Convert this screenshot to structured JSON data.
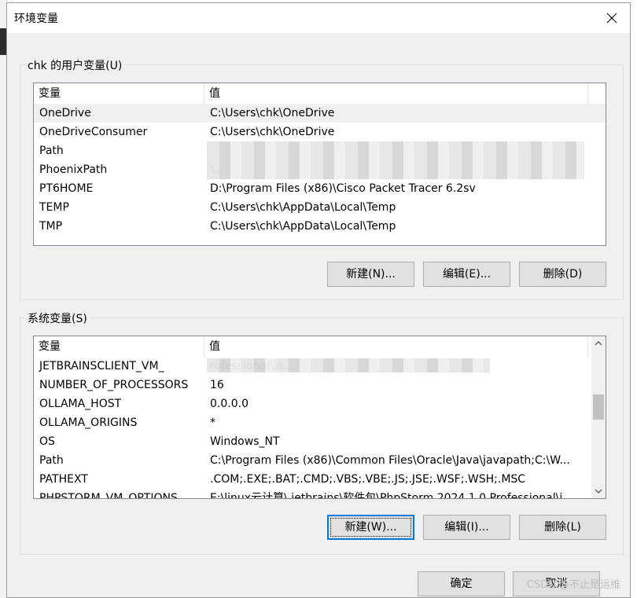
{
  "window": {
    "title": "环境变量",
    "close_glyph": "close-icon"
  },
  "user_vars": {
    "group_label": "chk 的用户变量(U)",
    "headers": {
      "name": "变量",
      "value": "值"
    },
    "rows": [
      {
        "name": "OneDrive",
        "value": "C:\\Users\\chk\\OneDrive",
        "selected": true
      },
      {
        "name": "OneDriveConsumer",
        "value": "C:\\Users\\chk\\OneDrive"
      },
      {
        "name": "Path",
        "value": ""
      },
      {
        "name": "PhoenixPath",
        "value": "\\..."
      },
      {
        "name": "PT6HOME",
        "value": "D:\\Program Files (x86)\\Cisco Packet Tracer 6.2sv"
      },
      {
        "name": "TEMP",
        "value": "C:\\Users\\chk\\AppData\\Local\\Temp"
      },
      {
        "name": "TMP",
        "value": "C:\\Users\\chk\\AppData\\Local\\Temp"
      }
    ],
    "buttons": {
      "new": "新建(N)...",
      "edit": "编辑(E)...",
      "delete": "删除(D)"
    }
  },
  "system_vars": {
    "group_label": "系统变量(S)",
    "headers": {
      "name": "变量",
      "value": "值"
    },
    "rows": [
      {
        "name": "JETBRAINSCLIENT_VM_",
        "value": "rofessional\\ja..."
      },
      {
        "name": "NUMBER_OF_PROCESSORS",
        "value": "16"
      },
      {
        "name": "OLLAMA_HOST",
        "value": "0.0.0.0"
      },
      {
        "name": "OLLAMA_ORIGINS",
        "value": "*"
      },
      {
        "name": "OS",
        "value": "Windows_NT"
      },
      {
        "name": "Path",
        "value": "C:\\Program Files (x86)\\Common Files\\Oracle\\Java\\javapath;C:\\W..."
      },
      {
        "name": "PATHEXT",
        "value": ".COM;.EXE;.BAT;.CMD;.VBS;.VBE;.JS;.JSE;.WSF;.WSH;.MSC"
      },
      {
        "name": "PHPSTORM_VM_OPTIONS",
        "value": "E:\\linux云计算\\.jetbrains\\软件包\\PhpStorm 2024.1.0 Professional\\j..."
      }
    ],
    "buttons": {
      "new": "新建(W)...",
      "edit": "编辑(I)...",
      "delete": "删除(L)"
    }
  },
  "footer": {
    "ok": "确定",
    "cancel": "取消"
  },
  "watermark": "CSDN @不止是运维"
}
